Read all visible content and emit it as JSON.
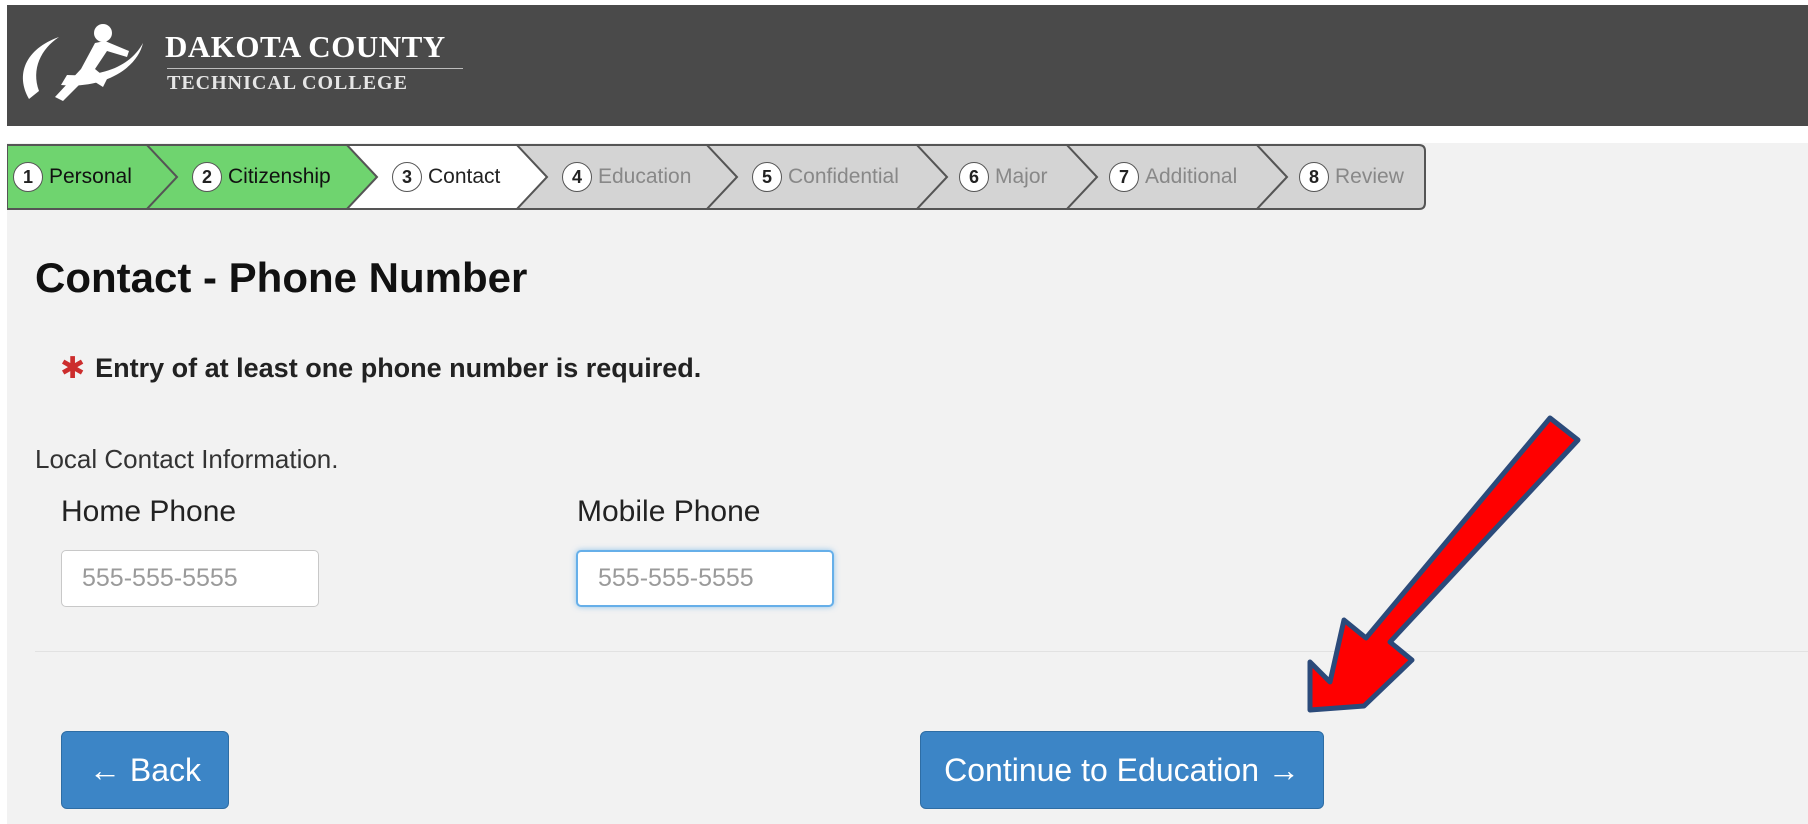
{
  "header": {
    "brand_line1": "DAKOTA COUNTY",
    "brand_line2": "TECHNICAL COLLEGE",
    "logo_icon": "runner-swoosh-logo",
    "background_color": "#4a4a4a"
  },
  "steps": [
    {
      "number": "1",
      "label": "Personal",
      "state": "done"
    },
    {
      "number": "2",
      "label": "Citizenship",
      "state": "done"
    },
    {
      "number": "3",
      "label": "Contact",
      "state": "current"
    },
    {
      "number": "4",
      "label": "Education",
      "state": "future"
    },
    {
      "number": "5",
      "label": "Confidential",
      "state": "future"
    },
    {
      "number": "6",
      "label": "Major",
      "state": "future"
    },
    {
      "number": "7",
      "label": "Additional",
      "state": "future"
    },
    {
      "number": "8",
      "label": "Review",
      "state": "future"
    }
  ],
  "step_colors": {
    "done": "#6fd46f",
    "current": "#ffffff",
    "future": "#d4d4d4"
  },
  "page": {
    "title": "Contact - Phone Number",
    "required_asterisk": "✱",
    "required_note": "Entry of at least one phone number is required.",
    "section_label": "Local Contact Information."
  },
  "form": {
    "home_phone_label": "Home Phone",
    "home_phone_placeholder": "555-555-5555",
    "home_phone_value": "",
    "mobile_phone_label": "Mobile Phone",
    "mobile_phone_placeholder": "555-555-5555",
    "mobile_phone_value": ""
  },
  "buttons": {
    "back_label": "← Back",
    "continue_label": "Continue to Education →",
    "color": "#3c85c6"
  },
  "annotation": {
    "icon": "red-arrow-icon",
    "color": "#ff0000"
  }
}
